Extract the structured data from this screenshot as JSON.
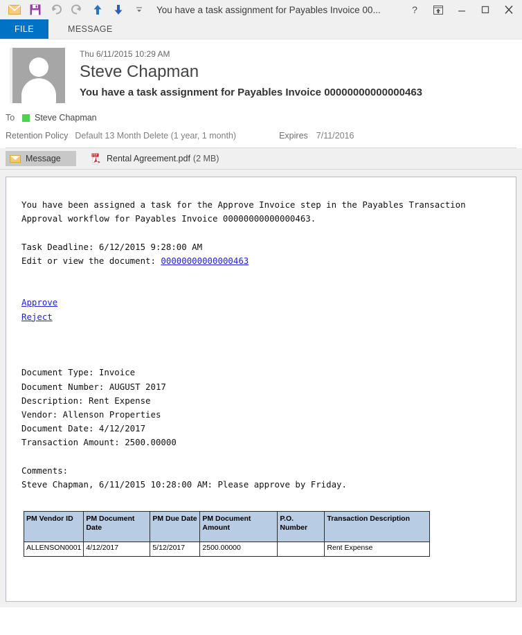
{
  "titlebar": {
    "title": "You have a task assignment for Payables Invoice 00...",
    "qat": [
      {
        "name": "envelope-icon",
        "label": "Message"
      },
      {
        "name": "save-icon",
        "label": "Save"
      },
      {
        "name": "undo-icon",
        "label": "Undo"
      },
      {
        "name": "redo-icon",
        "label": "Redo"
      },
      {
        "name": "previous-item-icon",
        "label": "Previous Item"
      },
      {
        "name": "next-item-icon",
        "label": "Next Item"
      },
      {
        "name": "customize-quick-access-toolbar-icon",
        "label": "Customize Quick Access Toolbar"
      }
    ],
    "controls": {
      "help": "?",
      "popout": "Pop Out",
      "minimize": "—",
      "maximize": "☐",
      "close": "✕"
    }
  },
  "ribbon": {
    "file_tab": "FILE",
    "message_tab": "MESSAGE"
  },
  "header": {
    "sent_date": "Thu 6/11/2015 10:29 AM",
    "sender": "Steve Chapman",
    "subject": "You have a task assignment for Payables Invoice 00000000000000463",
    "to_label": "To",
    "to_name": "Steve Chapman",
    "retention_label": "Retention Policy",
    "retention_value": "Default 13 Month Delete (1 year, 1 month)",
    "expires_label": "Expires",
    "expires_value": "7/11/2016"
  },
  "attachments": {
    "message_tab": "Message",
    "items": [
      {
        "filename": "Rental Agreement.pdf",
        "size": "(2 MB)"
      }
    ]
  },
  "body": {
    "paragraph1": "You have been assigned a task for the Approve Invoice step in the Payables Transaction\nApproval workflow for Payables Invoice 00000000000000463.",
    "task_deadline": "Task Deadline: 6/12/2015 9:28:00 AM",
    "edit_label": "Edit or view the document: ",
    "document_link": "00000000000000463",
    "approve_link": "Approve",
    "reject_link": "Reject",
    "details": "Document Type: Invoice\nDocument Number: AUGUST 2017\nDescription: Rent Expense\nVendor: Allenson Properties\nDocument Date: 4/12/2017\nTransaction Amount: 2500.00000",
    "comments_label": "Comments:",
    "comments_value": "Steve Chapman, 6/11/2015 10:28:00 AM: Please approve by Friday."
  },
  "table": {
    "headers": [
      "PM Vendor ID",
      "PM Document Date",
      "PM Due Date",
      "PM Document Amount",
      "P.O. Number",
      "Transaction Description"
    ],
    "rows": [
      [
        "ALLENSON0001",
        "4/12/2017",
        "5/12/2017",
        "2500.00000",
        "",
        "Rent Expense"
      ]
    ]
  },
  "colors": {
    "file_tab_blue": "#0072c6",
    "link_blue": "#1f22d8",
    "presence_green": "#4dd351",
    "table_header_blue": "#b8cce4",
    "chrome_gray": "#f0f0f0"
  }
}
